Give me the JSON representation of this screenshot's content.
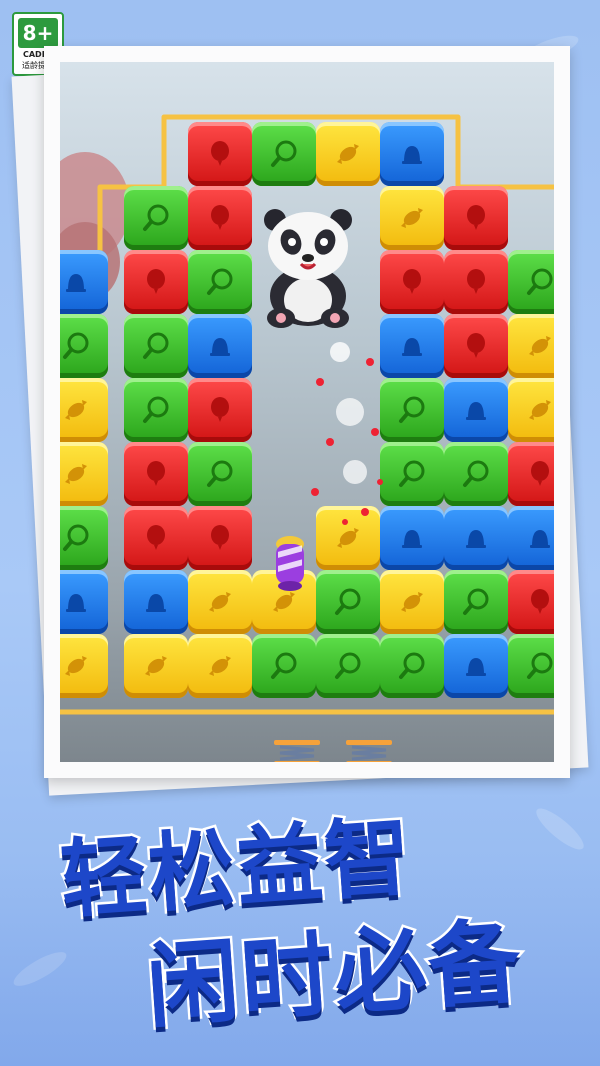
{
  "badge": {
    "age": "8+",
    "org": "CADPA",
    "tip": "适龄提示"
  },
  "slogan": {
    "line1": "轻松益智",
    "line2": "闲时必备"
  },
  "colors": {
    "red": "#e02020",
    "green": "#3cc12b",
    "blue": "#1f7ef0",
    "yellow": "#ffd21f",
    "slogan": "#1d47c9",
    "badge_green": "#2d9a3e"
  },
  "board": {
    "icons": {
      "red": "balloon-icon",
      "green": "magnifier-icon",
      "blue": "bell-icon",
      "yellow": "candy-icon"
    },
    "rows": [
      [
        "",
        "",
        "red",
        "green",
        "yellow",
        "blue",
        "",
        ""
      ],
      [
        "",
        "green",
        "red",
        "",
        "",
        "yellow",
        "red",
        ""
      ],
      [
        "blue",
        "red",
        "green",
        "",
        "",
        "red",
        "red",
        "green"
      ],
      [
        "green",
        "green",
        "blue",
        "",
        "",
        "blue",
        "red",
        "yellow"
      ],
      [
        "yellow",
        "green",
        "red",
        "",
        "",
        "green",
        "blue",
        "yellow"
      ],
      [
        "yellow",
        "red",
        "green",
        "",
        "",
        "green",
        "green",
        "red"
      ],
      [
        "green",
        "red",
        "red",
        "",
        "yellow",
        "blue",
        "blue",
        "blue"
      ],
      [
        "blue",
        "blue",
        "yellow",
        "yellow",
        "green",
        "yellow",
        "green",
        "red"
      ],
      [
        "yellow",
        "yellow",
        "yellow",
        "green",
        "green",
        "green",
        "blue",
        "green"
      ]
    ],
    "characters": [
      "panda",
      "rocket",
      "spring",
      "spring"
    ]
  }
}
